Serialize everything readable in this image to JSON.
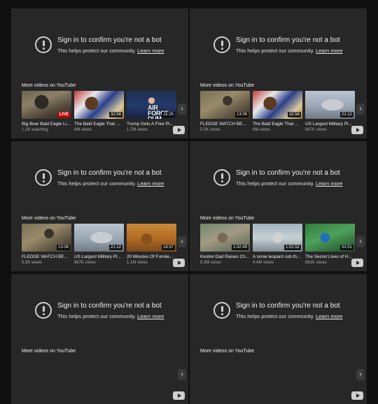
{
  "notice": {
    "title": "Sign in to confirm you're not a bot",
    "subtitle": "This helps protect our community.",
    "learn_more": "Learn more",
    "more_videos": "More videos on YouTube"
  },
  "panels": [
    {
      "videos": [
        {
          "title": "Big Bear Bald Eagle Li...",
          "meta": "1.2K watching",
          "badge": "LIVE",
          "img": "eagle-nest"
        },
        {
          "title": "The Bald Eagle That ...",
          "meta": "6M views",
          "badge": "32:58",
          "img": "eagle-flag"
        },
        {
          "title": "Trump Gets A Free Pl...",
          "meta": "1.7M views",
          "badge": "11:25",
          "img": "air-force",
          "img_text": "AIR FORCE DUM"
        }
      ]
    },
    {
      "videos": [
        {
          "title": "FLEDGE WATCH BEGI...",
          "meta": "5.5K views",
          "badge": "13:08",
          "img": "eagle-nest-2"
        },
        {
          "title": "The Bald Eagle That ...",
          "meta": "6M views",
          "badge": "32:58",
          "img": "eagle-flag"
        },
        {
          "title": "US Largest Military Pl...",
          "meta": "867K views",
          "badge": "21:12",
          "img": "plane"
        }
      ]
    },
    {
      "videos": [
        {
          "title": "FLEDGE WATCH BEGI...",
          "meta": "5.5K views",
          "badge": "13:08",
          "img": "eagle-nest-2"
        },
        {
          "title": "US Largest Military Pl...",
          "meta": "867K views",
          "badge": "21:12",
          "img": "plane"
        },
        {
          "title": "20 Minutes Of Funnie...",
          "meta": "1.1M views",
          "badge": "18:37",
          "img": "monkeys"
        }
      ]
    },
    {
      "videos": [
        {
          "title": "Kestrel Dad Raises Ch...",
          "meta": "8.3M views",
          "badge": "1:02:49",
          "img": "kestrel"
        },
        {
          "title": "A snow leopard cub th...",
          "meta": "4.4M views",
          "badge": "1:02:52",
          "img": "snow-leopard"
        },
        {
          "title": "The Secret Lives of H...",
          "meta": "661K views",
          "badge": "52:51",
          "img": "hummingbird"
        }
      ]
    },
    {
      "videos": []
    },
    {
      "videos": []
    }
  ],
  "colors": {
    "page_bg": "#0f0f0f",
    "panel_bg": "#272727",
    "text": "#f1f1f1",
    "meta": "#aaaaaa",
    "live": "#cc0000"
  }
}
